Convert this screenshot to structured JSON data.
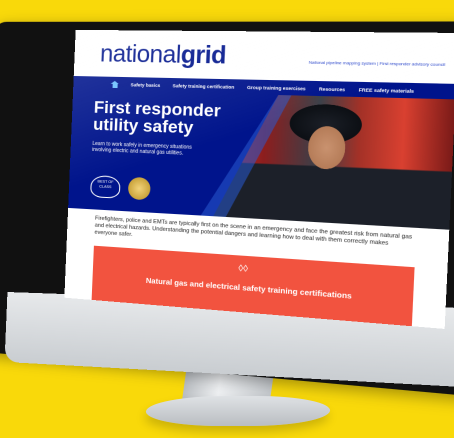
{
  "brand": {
    "light": "national",
    "bold": "grid"
  },
  "top_links": "National pipeline mapping system  |  First responder advisory council",
  "nav": [
    "Safety basics",
    "Safety training certification",
    "Group training exercises",
    "Resources",
    "FREE safety materials"
  ],
  "hero": {
    "title": "First responder utility safety",
    "description": "Learn to work safely in emergency situations involving electric and natural gas utilities.",
    "badge_text": "BEST OF CLASS"
  },
  "intro": "Firefighters, police and EMTs are typically first on the scene in an emergency and face the greatest risk from natural gas and electrical hazards. Understanding the potential dangers and learning how to deal with them correctly makes everyone safer.",
  "cert_banner": {
    "title": "Natural gas and electrical safety training certifications"
  },
  "colors": {
    "background": "#f9d90a",
    "brand_navy": "#00148c",
    "banner_coral": "#f2533f"
  },
  "icons": [
    "home-icon",
    "flame-icon",
    "chevron-down-icon"
  ]
}
